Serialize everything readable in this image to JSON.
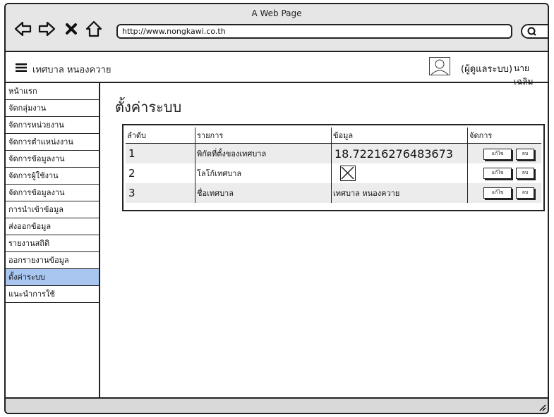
{
  "window": {
    "title": "A Web Page",
    "url": "http://www.nongkawi.co.th"
  },
  "icons": {
    "back": "arrow-left-icon",
    "forward": "arrow-right-icon",
    "close": "close-icon",
    "home": "home-icon",
    "search": "search-icon",
    "menu": "hamburger-icon",
    "user": "user-avatar-icon",
    "checkbox": "image-placeholder-icon",
    "resize": "resize-grip-icon"
  },
  "menubar": {
    "brand": "เทศบาล หนองควาย",
    "user_role": "(ผู้ดูแลระบบ)",
    "user_name": "นาย เฉลิม"
  },
  "sidebar": {
    "items": [
      {
        "label": "หน้าแรก"
      },
      {
        "label": "จัดกลุ่มงาน"
      },
      {
        "label": "จัดการหน่วยงาน"
      },
      {
        "label": "จัดการตำแหน่งงาน"
      },
      {
        "label": "จัดการข้อมูลงาน"
      },
      {
        "label": "จัดการผู้ใช้งาน"
      },
      {
        "label": "จัดการข้อมูลงาน"
      },
      {
        "label": "การนำเข้าข้อมูล"
      },
      {
        "label": "ส่งออกข้อมูล"
      },
      {
        "label": "รายงานสถิติ"
      },
      {
        "label": "ออกรายงานข้อมูล"
      },
      {
        "label": "ตั้งค่าระบบ"
      },
      {
        "label": "แนะนำการใช้"
      }
    ],
    "active_index": 11
  },
  "main": {
    "title": "ตั้งค่าระบบ",
    "table": {
      "headers": [
        "ลำดับ",
        "รายการ",
        "ข้อมูล",
        "จัดการ"
      ],
      "rows": [
        {
          "no": "1",
          "item": "พิกัดที่ตั้งของเทศบาล",
          "value": "18.72216276483673"
        },
        {
          "no": "2",
          "item": "โลโก้เทศบาล",
          "value": ""
        },
        {
          "no": "3",
          "item": "ชื่อเทศบาล",
          "value": "เทศบาล หนองควาย"
        }
      ],
      "actions": {
        "edit_label": "แก้ไข",
        "delete_label": "ลบ"
      }
    }
  },
  "colors": {
    "active_menu": "#a9c6f0",
    "chrome": "#e6e6e6",
    "row_alt": "#ececec"
  }
}
